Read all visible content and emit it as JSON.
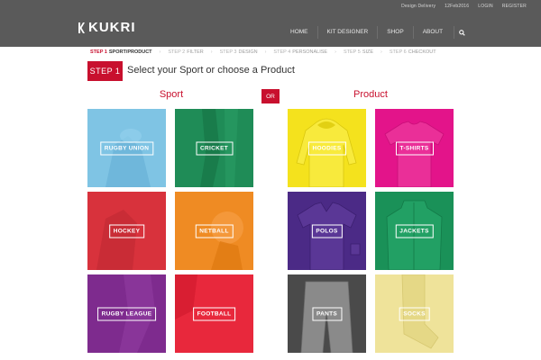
{
  "header": {
    "utility_links": [
      "Design Delivery",
      "12Feb2016",
      "LOGIN",
      "REGISTER"
    ],
    "logo_text": "KUKRI",
    "nav": [
      "HOME",
      "KIT DESIGNER",
      "SHOP",
      "ABOUT"
    ],
    "colors": {
      "bar": "#5a5a5a",
      "accent": "#c8102e"
    }
  },
  "steps": [
    {
      "num": "STEP 1",
      "label": "SPORT/PRODUCT",
      "active": true
    },
    {
      "num": "STEP 2",
      "label": "FILTER",
      "active": false
    },
    {
      "num": "STEP 3",
      "label": "DESIGN",
      "active": false
    },
    {
      "num": "STEP 4",
      "label": "PERSONALISE",
      "active": false
    },
    {
      "num": "STEP 5",
      "label": "SIZE",
      "active": false
    },
    {
      "num": "STEP 6",
      "label": "CHECKOUT",
      "active": false
    }
  ],
  "title": {
    "badge": "STEP 1",
    "text": "Select your Sport or choose a Product"
  },
  "sport": {
    "heading": "Sport",
    "tiles": [
      {
        "label": "RUGBY UNION",
        "color": "#7fc4e4"
      },
      {
        "label": "CRICKET",
        "color": "#1f8c57"
      },
      {
        "label": "HOCKEY",
        "color": "#d8323c"
      },
      {
        "label": "NETBALL",
        "color": "#ef8b23"
      },
      {
        "label": "RUGBY LEAGUE",
        "color": "#7e2b8e"
      },
      {
        "label": "FOOTBALL",
        "color": "#e8283c"
      }
    ]
  },
  "or_label": "OR",
  "product": {
    "heading": "Product",
    "tiles": [
      {
        "label": "HOODIES",
        "color": "#f4e21d",
        "icon": "hoodie-icon"
      },
      {
        "label": "T-SHIRTS",
        "color": "#e3148a",
        "icon": "tshirt-icon"
      },
      {
        "label": "POLOS",
        "color": "#4b2a86",
        "icon": "polo-icon"
      },
      {
        "label": "JACKETS",
        "color": "#1a9158",
        "icon": "jacket-icon"
      },
      {
        "label": "PANTS",
        "color": "#4a4a4a",
        "icon": "pants-icon"
      },
      {
        "label": "SOCKS",
        "color": "#efe39a",
        "icon": "socks-icon"
      }
    ]
  }
}
